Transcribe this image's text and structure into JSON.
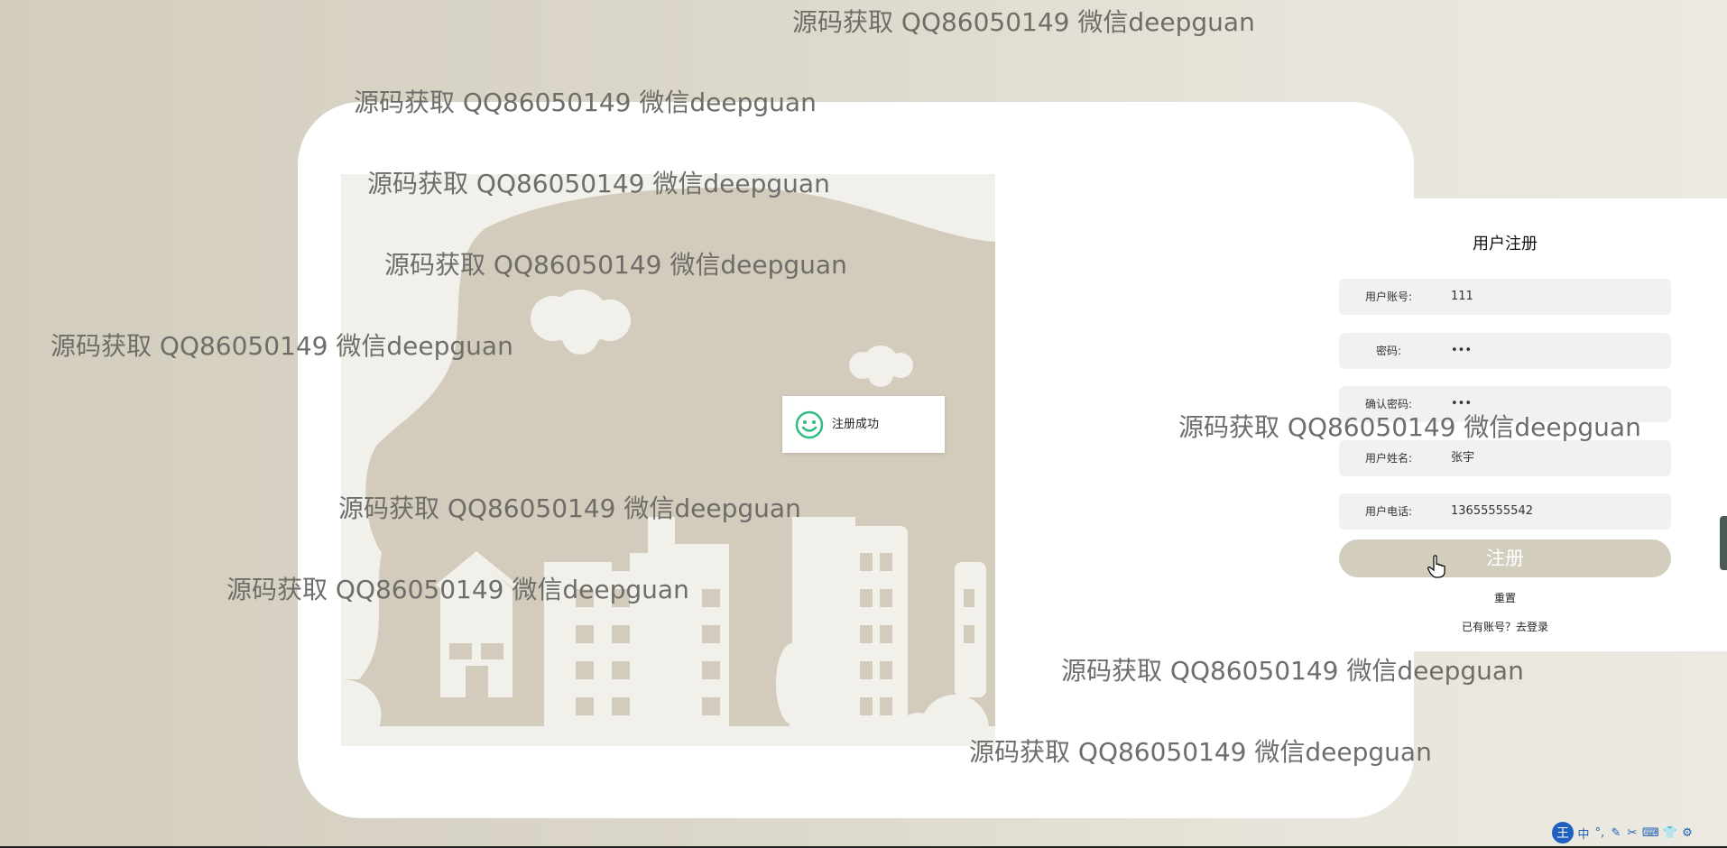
{
  "register": {
    "title": "用户注册",
    "fields": [
      {
        "label": "用户账号:",
        "value": "111"
      },
      {
        "label": "密码:",
        "value": "•••"
      },
      {
        "label": "确认密码:",
        "value": "•••"
      },
      {
        "label": "用户姓名:",
        "value": "张宇"
      },
      {
        "label": "用户电话:",
        "value": "13655555542"
      }
    ],
    "submit_label": "注册",
    "reset_label": "重置",
    "login_link_label": "已有账号？去登录"
  },
  "toast": {
    "message": "注册成功"
  },
  "watermark": {
    "text": "源码获取 QQ86050149 微信deepguan"
  },
  "ime_toolbar": {
    "logo": "王",
    "items": [
      "中",
      "°,",
      "✎",
      "✂",
      "⌨",
      "👕",
      "⚙"
    ]
  },
  "colors": {
    "accent": "#d3cdbd",
    "card": "#ffffff",
    "illustration_bg": "#d3cbbb",
    "illustration_fg": "#f2f0ea",
    "toast_icon": "#2dbd80"
  }
}
